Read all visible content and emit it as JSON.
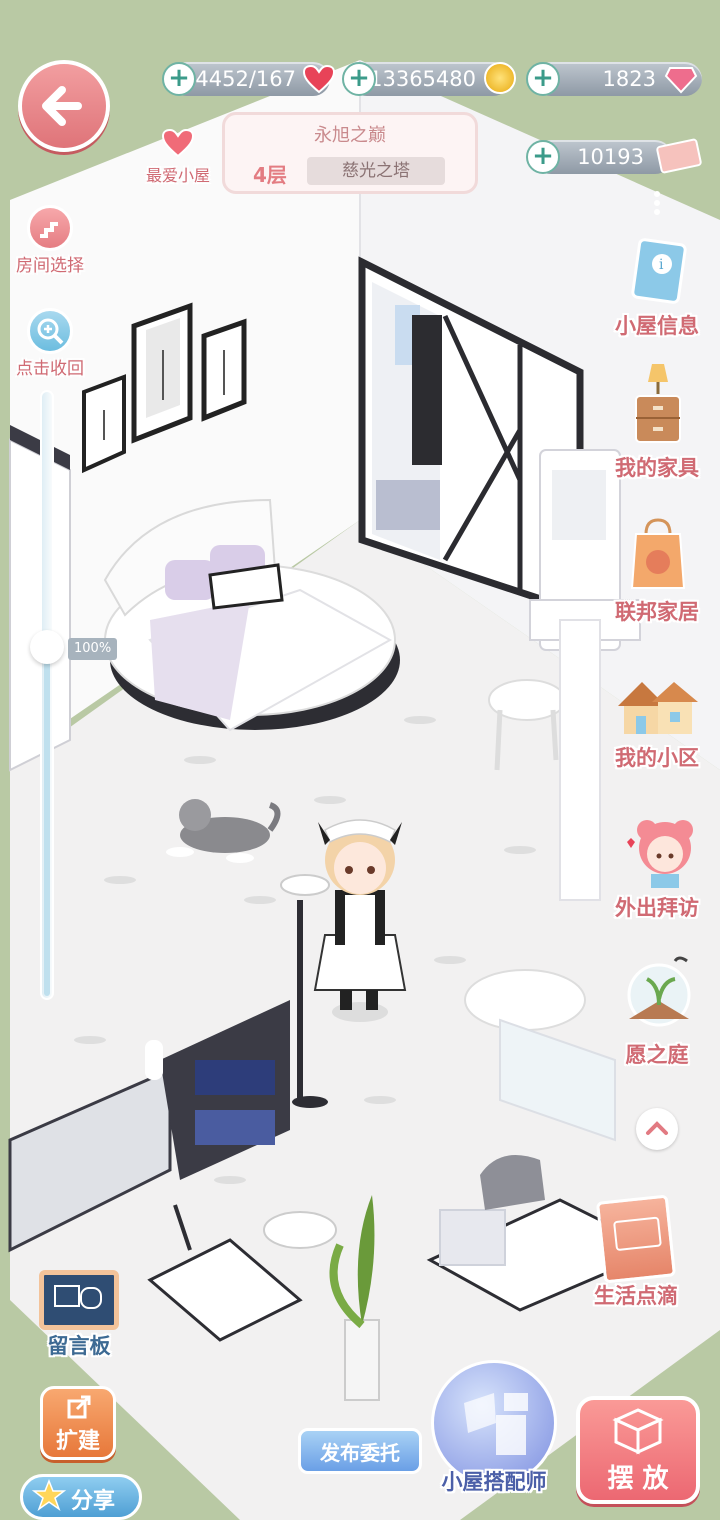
{
  "header": {
    "back_icon": "arrow-left-icon",
    "favorite_label": "最爱小屋",
    "room_title": "永旭之巅",
    "floor": "4层",
    "tower_name": "慈光之塔"
  },
  "currencies": [
    {
      "value": "4452/167",
      "icon": "heart-icon",
      "color": "#e84358"
    },
    {
      "value": "13365480",
      "icon": "gold-coin-icon",
      "color": "#f4c21f"
    },
    {
      "value": "1823",
      "icon": "diamond-icon",
      "color": "#e9597c"
    },
    {
      "value": "10193",
      "icon": "ticket-icon",
      "color": "#f0a7a2"
    }
  ],
  "left_menu": {
    "room_select": "房间选择",
    "collapse": "点击收回",
    "zoom": "100%"
  },
  "right_menu": [
    {
      "label": "小屋信息",
      "icon": "info-book-icon"
    },
    {
      "label": "我的家具",
      "icon": "cabinet-lamp-icon"
    },
    {
      "label": "联邦家居",
      "icon": "shopping-bag-icon"
    },
    {
      "label": "我的小区",
      "icon": "houses-icon"
    },
    {
      "label": "外出拜访",
      "icon": "girl-avatar-icon"
    },
    {
      "label": "愿之庭",
      "icon": "sprout-globe-icon"
    }
  ],
  "bottom": {
    "message_board": "留言板",
    "life_moments": "生活点滴",
    "expand": "扩建",
    "share": "分享",
    "publish_commission": "发布委托",
    "room_designer": "小屋搭配师",
    "place": "摆 放"
  },
  "colors": {
    "accent_pink": "#e8797f",
    "label_pink": "#d06a73",
    "background_green": "#b9c9a4",
    "floor_white": "#f2f1f1"
  }
}
